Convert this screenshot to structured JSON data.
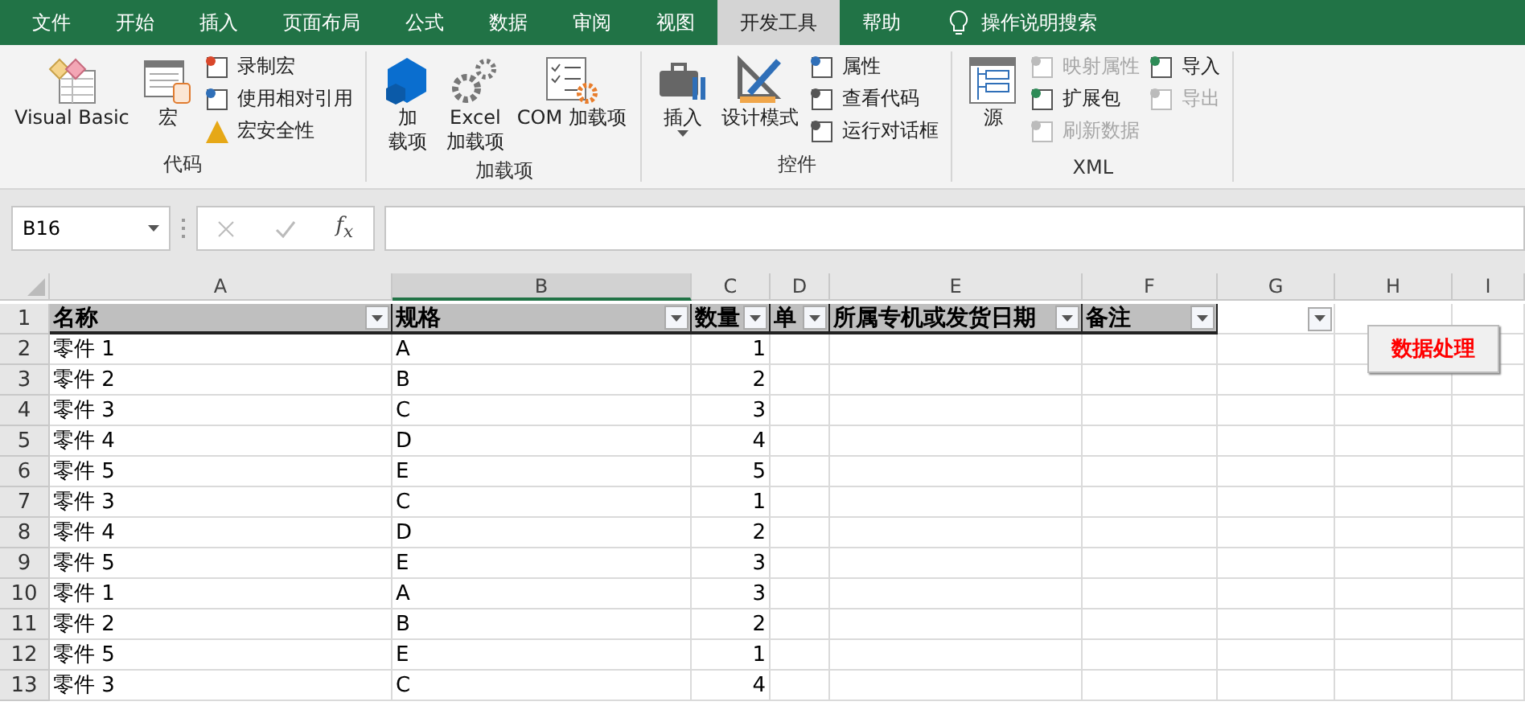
{
  "tabs": [
    {
      "label": "文件",
      "selected": false
    },
    {
      "label": "开始",
      "selected": false
    },
    {
      "label": "插入",
      "selected": false
    },
    {
      "label": "页面布局",
      "selected": false
    },
    {
      "label": "公式",
      "selected": false
    },
    {
      "label": "数据",
      "selected": false
    },
    {
      "label": "审阅",
      "selected": false
    },
    {
      "label": "视图",
      "selected": false
    },
    {
      "label": "开发工具",
      "selected": true
    },
    {
      "label": "帮助",
      "selected": false
    }
  ],
  "tell_me": "操作说明搜索",
  "groups": [
    {
      "label": "代码",
      "items": [
        {
          "kind": "large",
          "lines": [
            "Visual Basic"
          ]
        },
        {
          "kind": "large",
          "lines": [
            "宏"
          ]
        },
        {
          "kind": "small",
          "label": "录制宏",
          "disabled": false
        },
        {
          "kind": "small",
          "label": "使用相对引用",
          "disabled": false
        },
        {
          "kind": "small",
          "label": "宏安全性",
          "disabled": false
        }
      ]
    },
    {
      "label": "加载项",
      "items": [
        {
          "kind": "large",
          "lines": [
            "加",
            "载项"
          ]
        },
        {
          "kind": "large",
          "lines": [
            "Excel",
            "加载项"
          ]
        },
        {
          "kind": "large",
          "lines": [
            "COM 加载项"
          ]
        }
      ]
    },
    {
      "label": "控件",
      "items": [
        {
          "kind": "large",
          "lines": [
            "插入"
          ],
          "dropdown": true
        },
        {
          "kind": "large",
          "lines": [
            "设计模式"
          ]
        },
        {
          "kind": "small",
          "label": "属性",
          "disabled": false
        },
        {
          "kind": "small",
          "label": "查看代码",
          "disabled": false
        },
        {
          "kind": "small",
          "label": "运行对话框",
          "disabled": false
        }
      ]
    },
    {
      "label": "XML",
      "items": [
        {
          "kind": "large",
          "lines": [
            "源"
          ]
        },
        {
          "kind": "small",
          "label": "映射属性",
          "disabled": true
        },
        {
          "kind": "small",
          "label": "扩展包",
          "disabled": false
        },
        {
          "kind": "small",
          "label": "刷新数据",
          "disabled": true
        },
        {
          "kind": "small",
          "label": "导入",
          "disabled": false
        },
        {
          "kind": "small",
          "label": "导出",
          "disabled": true
        }
      ]
    }
  ],
  "formula_bar": {
    "name_box": "B16",
    "fx": "f$_{x}$"
  },
  "columns": [
    {
      "label": "A",
      "selected": false
    },
    {
      "label": "B",
      "selected": true
    },
    {
      "label": "C",
      "selected": false
    },
    {
      "label": "D",
      "selected": false
    },
    {
      "label": "E",
      "selected": false
    },
    {
      "label": "F",
      "selected": false
    },
    {
      "label": "G",
      "selected": false
    },
    {
      "label": "H",
      "selected": false
    },
    {
      "label": "I",
      "selected": false
    }
  ],
  "header_row": {
    "number": "1",
    "cells": [
      {
        "text": "名称",
        "filter": true
      },
      {
        "text": "规格",
        "filter": true
      },
      {
        "text": "数量",
        "filter": true
      },
      {
        "text": "单",
        "filter": true
      },
      {
        "text": "所属专机或发货日期",
        "filter": true
      },
      {
        "text": "备注",
        "filter": true
      },
      {
        "filter": true
      }
    ]
  },
  "rows": [
    {
      "number": "2",
      "cells": [
        "零件 1",
        "A",
        "1"
      ]
    },
    {
      "number": "3",
      "cells": [
        "零件 2",
        "B",
        "2"
      ]
    },
    {
      "number": "4",
      "cells": [
        "零件 3",
        "C",
        "3"
      ]
    },
    {
      "number": "5",
      "cells": [
        "零件 4",
        "D",
        "4"
      ]
    },
    {
      "number": "6",
      "cells": [
        "零件 5",
        "E",
        "5"
      ]
    },
    {
      "number": "7",
      "cells": [
        "零件 3",
        "C",
        "1"
      ]
    },
    {
      "number": "8",
      "cells": [
        "零件 4",
        "D",
        "2"
      ]
    },
    {
      "number": "9",
      "cells": [
        "零件 5",
        "E",
        "3"
      ]
    },
    {
      "number": "10",
      "cells": [
        "零件 1",
        "A",
        "3"
      ]
    },
    {
      "number": "11",
      "cells": [
        "零件 2",
        "B",
        "2"
      ]
    },
    {
      "number": "12",
      "cells": [
        "零件 5",
        "E",
        "1"
      ]
    },
    {
      "number": "13",
      "cells": [
        "零件 3",
        "C",
        "4"
      ]
    }
  ],
  "sheet_button": "数据处理"
}
